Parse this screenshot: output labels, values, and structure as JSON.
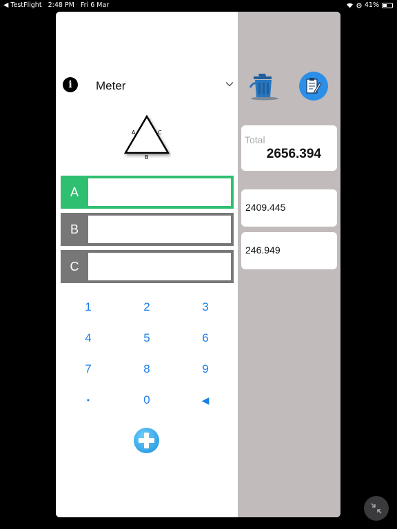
{
  "statusbar": {
    "back_app": "◀ TestFlight",
    "time": "2:48 PM",
    "date": "Fri 6 Mar",
    "battery": "41%"
  },
  "header": {
    "info_glyph": "i",
    "unit": "Meter"
  },
  "triangle": {
    "labels": {
      "a": "A",
      "b": "B",
      "c": "C"
    }
  },
  "fields": [
    {
      "label": "A",
      "value": "",
      "active": true
    },
    {
      "label": "B",
      "value": "",
      "active": false
    },
    {
      "label": "C",
      "value": "",
      "active": false
    }
  ],
  "keypad": {
    "keys": [
      "1",
      "2",
      "3",
      "4",
      "5",
      "6",
      "7",
      "8",
      "9",
      "•",
      "0",
      "◀"
    ]
  },
  "results": {
    "total_label": "Total",
    "total_value": "2656.394",
    "values": [
      "2409.445",
      "246.949"
    ]
  },
  "icons": {
    "info": "info-icon",
    "chevron": "chevron-down-icon",
    "trash": "trash-icon",
    "notes": "notes-icon",
    "add": "add-icon",
    "collapse": "collapse-icon"
  },
  "colors": {
    "active_field": "#2fbf71",
    "inactive_field": "#777777",
    "accent": "#1a7fe8",
    "sidebar": "#c2bbbb"
  }
}
